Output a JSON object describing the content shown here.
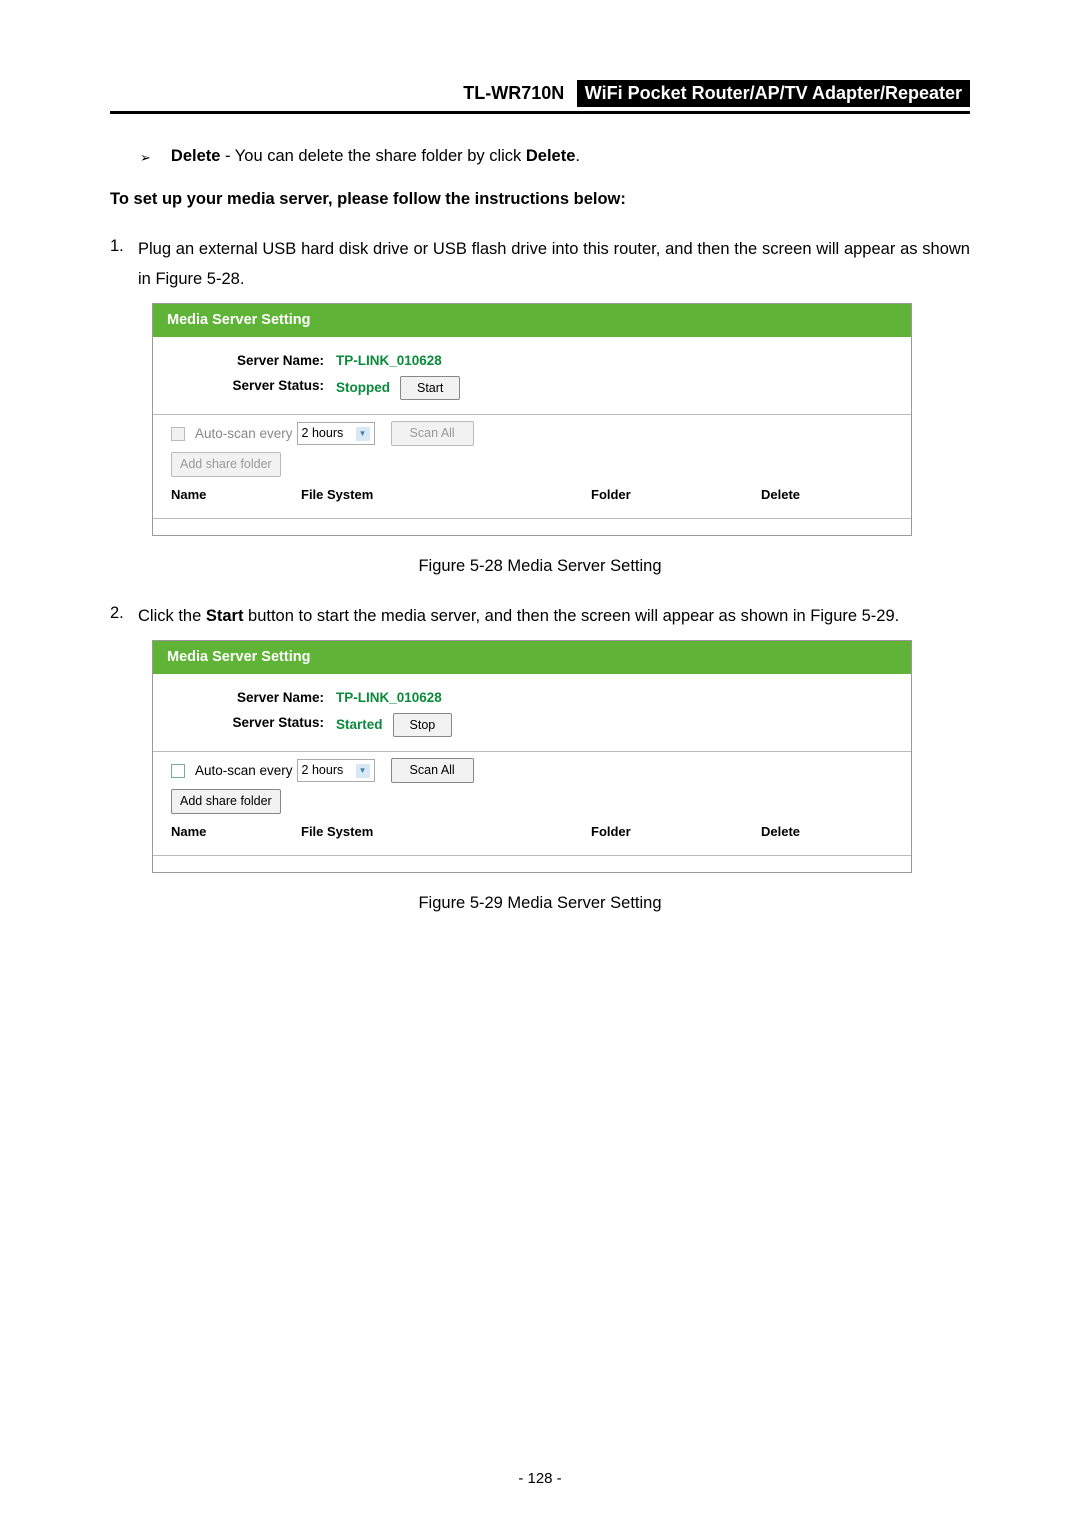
{
  "header": {
    "model": "TL-WR710N",
    "desc": "WiFi  Pocket  Router/AP/TV  Adapter/Repeater"
  },
  "bullet": {
    "symbol": "➢",
    "label": "Delete",
    "text": " - You can delete the share folder by click ",
    "label2": "Delete",
    "tail": "."
  },
  "subheading": "To set up your media server, please follow the instructions below:",
  "step1": {
    "num": "1.",
    "text_a": "Plug an external USB hard disk drive or USB flash drive into this router, and then the screen will appear as shown in ",
    "ref": "Figure 5-28",
    "tail": "."
  },
  "fig1": {
    "title": "Media Server Setting",
    "server_name_lbl": "Server Name:",
    "server_name_val": "TP-LINK_010628",
    "server_status_lbl": "Server Status:",
    "server_status_val": "Stopped",
    "start_btn": "Start",
    "autoscan_lbl": "Auto-scan every",
    "autoscan_val": "2 hours",
    "scanall_btn": "Scan All",
    "addshare_btn": "Add share folder",
    "col_name": "Name",
    "col_fs": "File System",
    "col_folder": "Folder",
    "col_delete": "Delete"
  },
  "caption1": "Figure 5-28 Media Server Setting",
  "step2": {
    "num": "2.",
    "text_a": "Click the ",
    "bold": "Start",
    "text_b": " button to start the media server, and then the screen will appear as shown in ",
    "ref": "Figure 5-29",
    "tail": "."
  },
  "fig2": {
    "title": "Media Server Setting",
    "server_name_lbl": "Server Name:",
    "server_name_val": "TP-LINK_010628",
    "server_status_lbl": "Server Status:",
    "server_status_val": "Started",
    "stop_btn": "Stop",
    "autoscan_lbl": "Auto-scan every",
    "autoscan_val": "2 hours",
    "scanall_btn": "Scan All",
    "addshare_btn": "Add share folder",
    "col_name": "Name",
    "col_fs": "File System",
    "col_folder": "Folder",
    "col_delete": "Delete"
  },
  "caption2": "Figure 5-29 Media Server Setting",
  "page_number": "- 128 -"
}
